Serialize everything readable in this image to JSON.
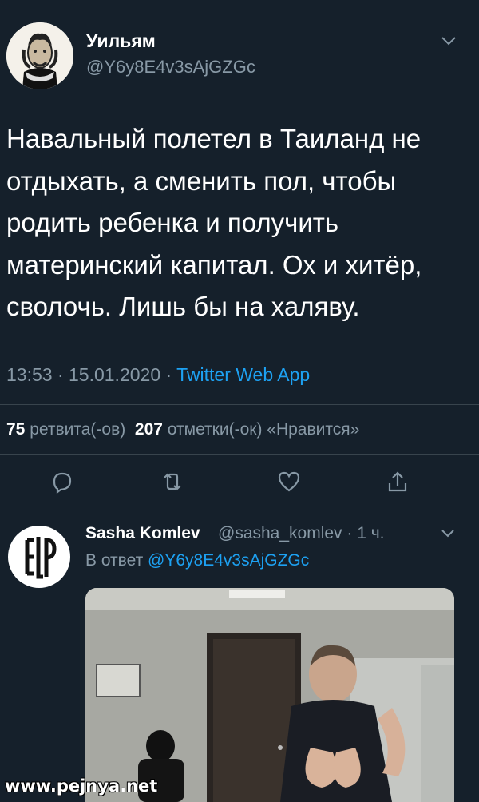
{
  "tweet": {
    "author_name": "Уильям",
    "author_handle": "@Y6y8E4v3sAjGZGc",
    "text": "Навальный полетел в Таиланд не отдыхать, а сменить пол, чтобы родить ребенка и получить материнский капитал. Ох и хитёр, сволочь. Лишь бы на халяву.",
    "time": "13:53 · 15.01.2020 · ",
    "source": "Twitter Web App",
    "retweets_count": "75",
    "retweets_label": " ретвита(-ов)",
    "likes_count": "207",
    "likes_label": " отметки(-ок) «Нравится»"
  },
  "actions": {
    "icons": [
      "reply-icon",
      "retweet-icon",
      "like-icon",
      "share-icon"
    ]
  },
  "reply": {
    "author_name": "Sasha Komlev",
    "author_handle": "@sasha_komlev · 1 ч.",
    "in_reply_prefix": "В ответ ",
    "in_reply_mention": "@Y6y8E4v3sAjGZGc"
  },
  "watermark": "www.pejnya.net",
  "colors": {
    "background": "#15202b",
    "accent": "#1da1f2",
    "secondary_text": "#8899a6",
    "divider": "#38444d"
  }
}
